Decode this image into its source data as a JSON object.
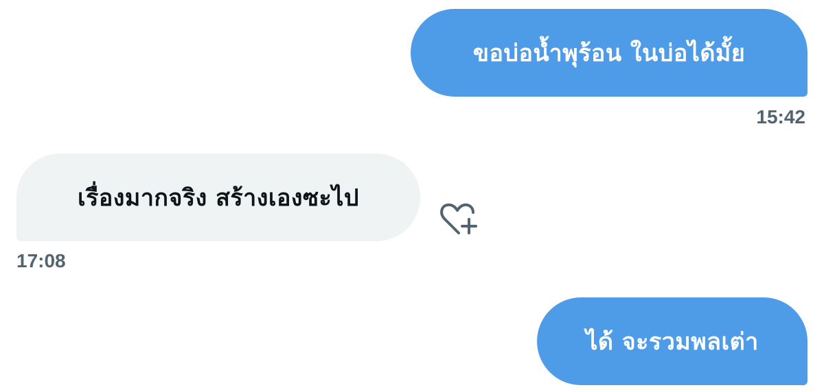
{
  "messages": [
    {
      "direction": "outgoing",
      "text": "ขอบ่อน้ำพุร้อน ในบ่อได้มั้ย",
      "time": "15:42"
    },
    {
      "direction": "incoming",
      "text": "เรื่องมากจริง สร้างเองซะไป",
      "time": "17:08"
    },
    {
      "direction": "outgoing",
      "text": "ได้ จะรวมพลเต่า"
    }
  ],
  "icons": {
    "reaction": "heart-plus-icon"
  },
  "colors": {
    "outgoing_bubble": "#4e9be8",
    "incoming_bubble": "#eff3f4",
    "timestamp": "#536471"
  }
}
